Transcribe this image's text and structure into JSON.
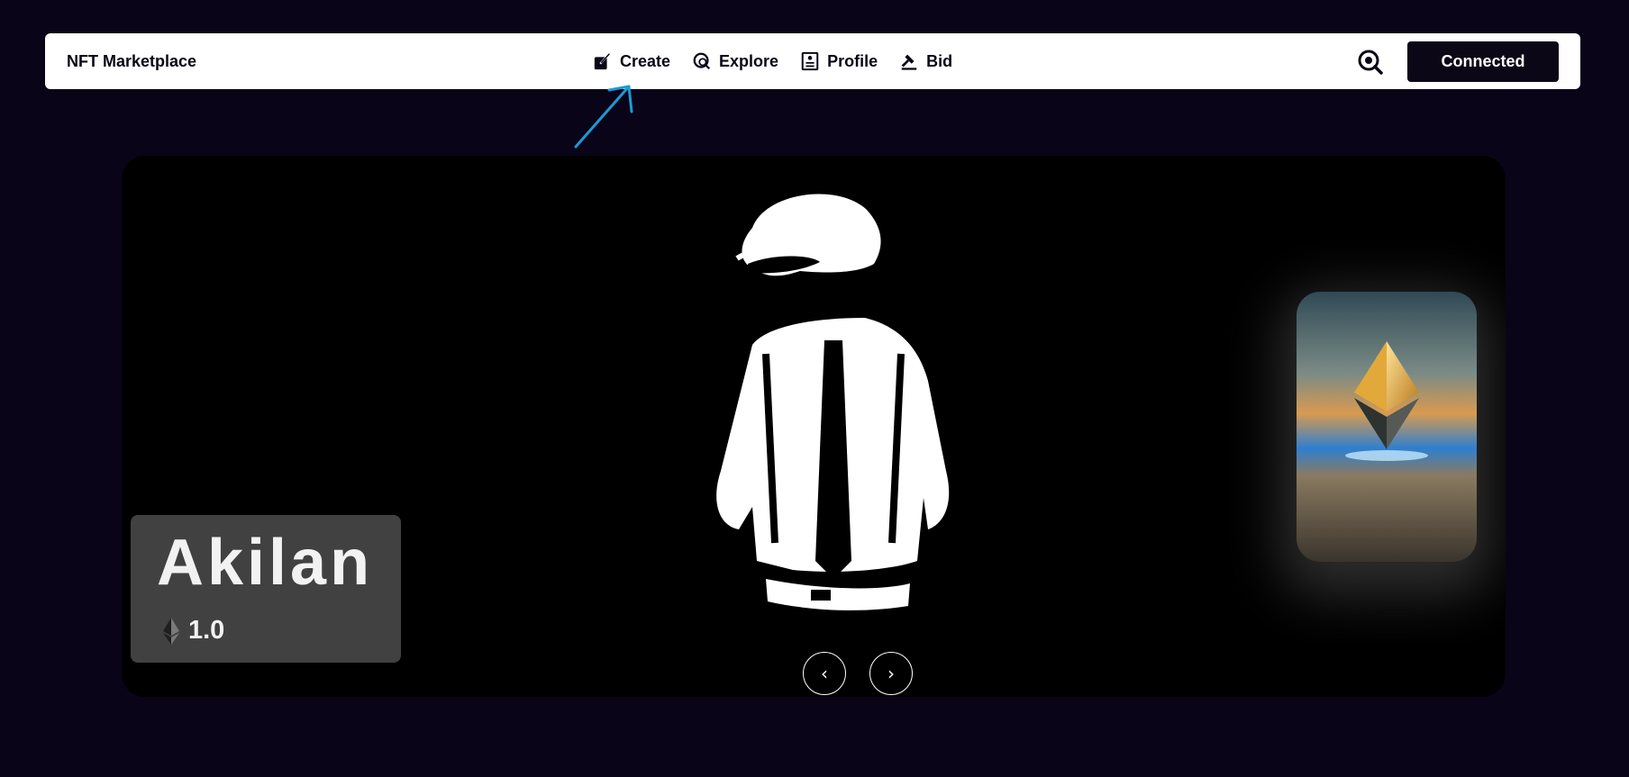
{
  "navbar": {
    "brand": "NFT Marketplace",
    "links": [
      {
        "label": "Create",
        "icon": "create-icon"
      },
      {
        "label": "Explore",
        "icon": "explore-icon"
      },
      {
        "label": "Profile",
        "icon": "profile-icon"
      },
      {
        "label": "Bid",
        "icon": "bid-icon"
      }
    ],
    "search_icon": "search-icon",
    "connect_label": "Connected"
  },
  "hero": {
    "nft_name": "Akilan",
    "price": "1.0",
    "currency_icon": "ethereum-icon",
    "prev_symbol": "‹",
    "next_symbol": "›"
  },
  "colors": {
    "background": "#0a0418",
    "navbar_bg": "#ffffff",
    "button_bg": "#0b0716",
    "card_bg": "#414141",
    "annotation": "#1a9ad6"
  }
}
